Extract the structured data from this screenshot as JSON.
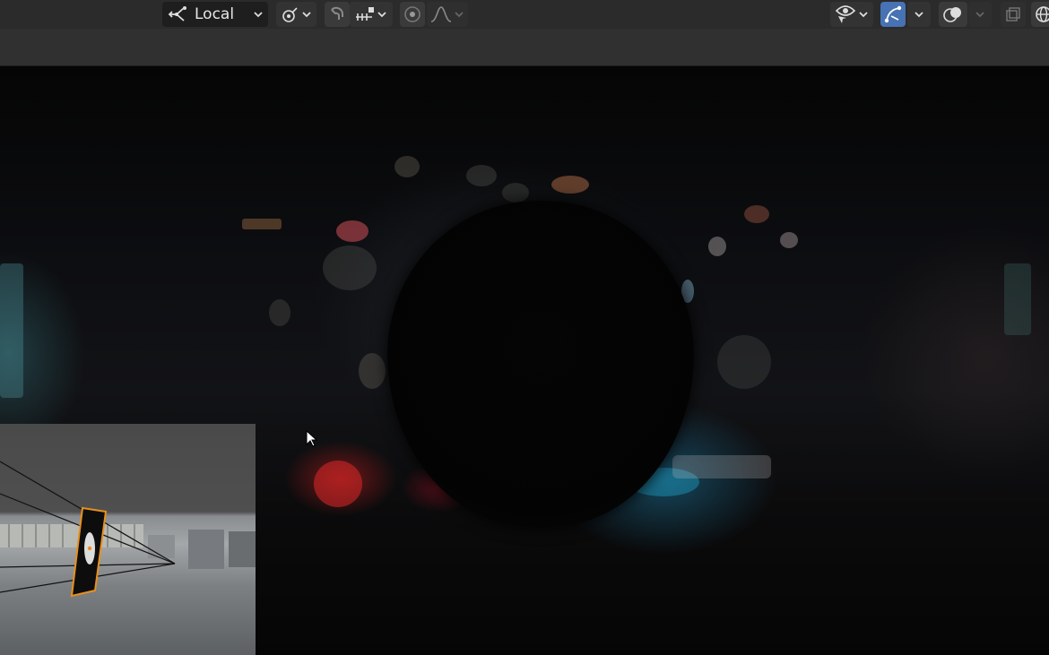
{
  "header": {
    "orientation": {
      "label": "Local",
      "icon": "transform-orientation-icon"
    },
    "pivot_icon": "pivot-point-icon",
    "snap_icon": "magnet-icon",
    "snap_target_icon": "snap-increment-icon",
    "proportional_icon": "proportional-editing-icon",
    "falloff_icon": "falloff-curve-icon",
    "visibility_icon": "eye-icon",
    "gizmo_icon": "gizmo-icon",
    "overlay_icon": "overlay-icon",
    "xray_icon": "xray-icon",
    "shading_icon": "wireframe-sphere-icon"
  },
  "viewport": {
    "scene": "night-city-bokeh",
    "preview": "camera-inset"
  },
  "colors": {
    "header_bg": "#2b2b2b",
    "active_button": "#4772b3",
    "selection_outline": "#e8901c"
  }
}
